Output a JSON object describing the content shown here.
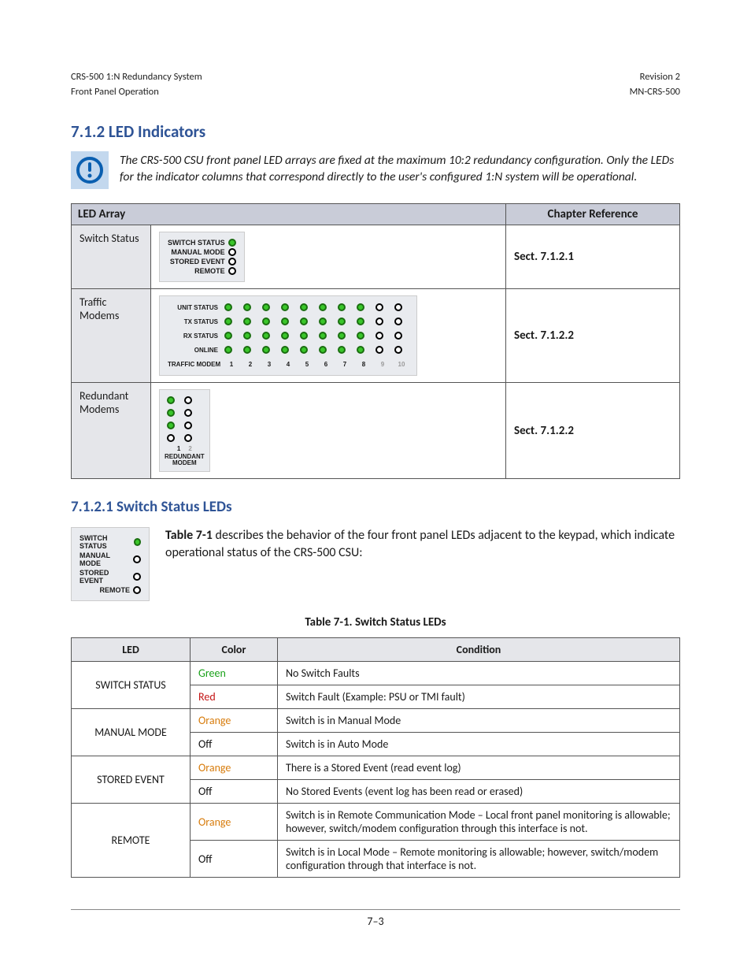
{
  "header": {
    "left_line1": "CRS-500 1:N Redundancy System",
    "left_line2": "Front Panel Operation",
    "right_line1": "Revision 2",
    "right_line2": "MN-CRS-500"
  },
  "section_title": "7.1.2   LED Indicators",
  "note_text": "The CRS-500 CSU front panel LED arrays are fixed at the maximum 10:2 redundancy configuration. Only the LEDs for the indicator columns that correspond directly to the user's configured 1:N system will be operational.",
  "layout_table": {
    "headers": [
      "LED Array",
      "",
      "Chapter Reference"
    ],
    "rows": [
      {
        "label": "Switch Status",
        "ref": "Sect. 7.1.2.1"
      },
      {
        "label": "Traffic Modems",
        "ref": "Sect. 7.1.2.2"
      },
      {
        "label": "Redundant Modems",
        "ref": "Sect. 7.1.2.2"
      }
    ]
  },
  "panel_switch": {
    "rows": [
      {
        "label": "SWITCH STATUS",
        "on": true
      },
      {
        "label": "MANUAL MODE",
        "on": false
      },
      {
        "label": "STORED EVENT",
        "on": false
      },
      {
        "label": "REMOTE",
        "on": false
      }
    ]
  },
  "panel_traffic": {
    "row_labels": [
      "UNIT STATUS",
      "TX STATUS",
      "RX STATUS",
      "ONLINE"
    ],
    "cols_on": 8,
    "cols_total": 10,
    "footer_label": "TRAFFIC MODEM"
  },
  "panel_redundant": {
    "cols_on": 1,
    "cols_total": 2,
    "footer_label": "REDUNDANT\nMODEM"
  },
  "sub_section_title": "7.1.2.1   Switch Status LEDs",
  "intro": {
    "bold": "Table 7-1",
    "rest": " describes the behavior of the four front panel LEDs adjacent to the keypad, which indicate operational status of the CRS-500 CSU:"
  },
  "table_caption": "Table 7-1. Switch Status LEDs",
  "led_table": {
    "headers": [
      "LED",
      "Color",
      "Condition"
    ],
    "rows": [
      {
        "led": "SWITCH STATUS",
        "color": "Green",
        "class": "c-green",
        "cond": "No Switch Faults"
      },
      {
        "led": "",
        "color": "Red",
        "class": "c-red",
        "cond": "Switch Fault (Example: PSU or TMI fault)"
      },
      {
        "led": "MANUAL MODE",
        "color": "Orange",
        "class": "c-orange",
        "cond": "Switch is in Manual Mode"
      },
      {
        "led": "",
        "color": "Off",
        "class": "c-off",
        "cond": "Switch is in Auto Mode"
      },
      {
        "led": "STORED EVENT",
        "color": "Orange",
        "class": "c-orange",
        "cond": "There is a Stored Event (read event log)"
      },
      {
        "led": "",
        "color": "Off",
        "class": "c-off",
        "cond": "No Stored Events (event log has been read or erased)"
      },
      {
        "led": "REMOTE",
        "color": "Orange",
        "class": "c-orange",
        "cond": "Switch is in Remote Communication Mode – Local front panel monitoring is allowable; however, switch/modem configuration through this interface is not."
      },
      {
        "led": "",
        "color": "Off",
        "class": "c-off",
        "cond": "Switch is in Local Mode – Remote monitoring is allowable; however, switch/modem configuration through that interface is not."
      }
    ]
  },
  "footer_page": "7–3"
}
